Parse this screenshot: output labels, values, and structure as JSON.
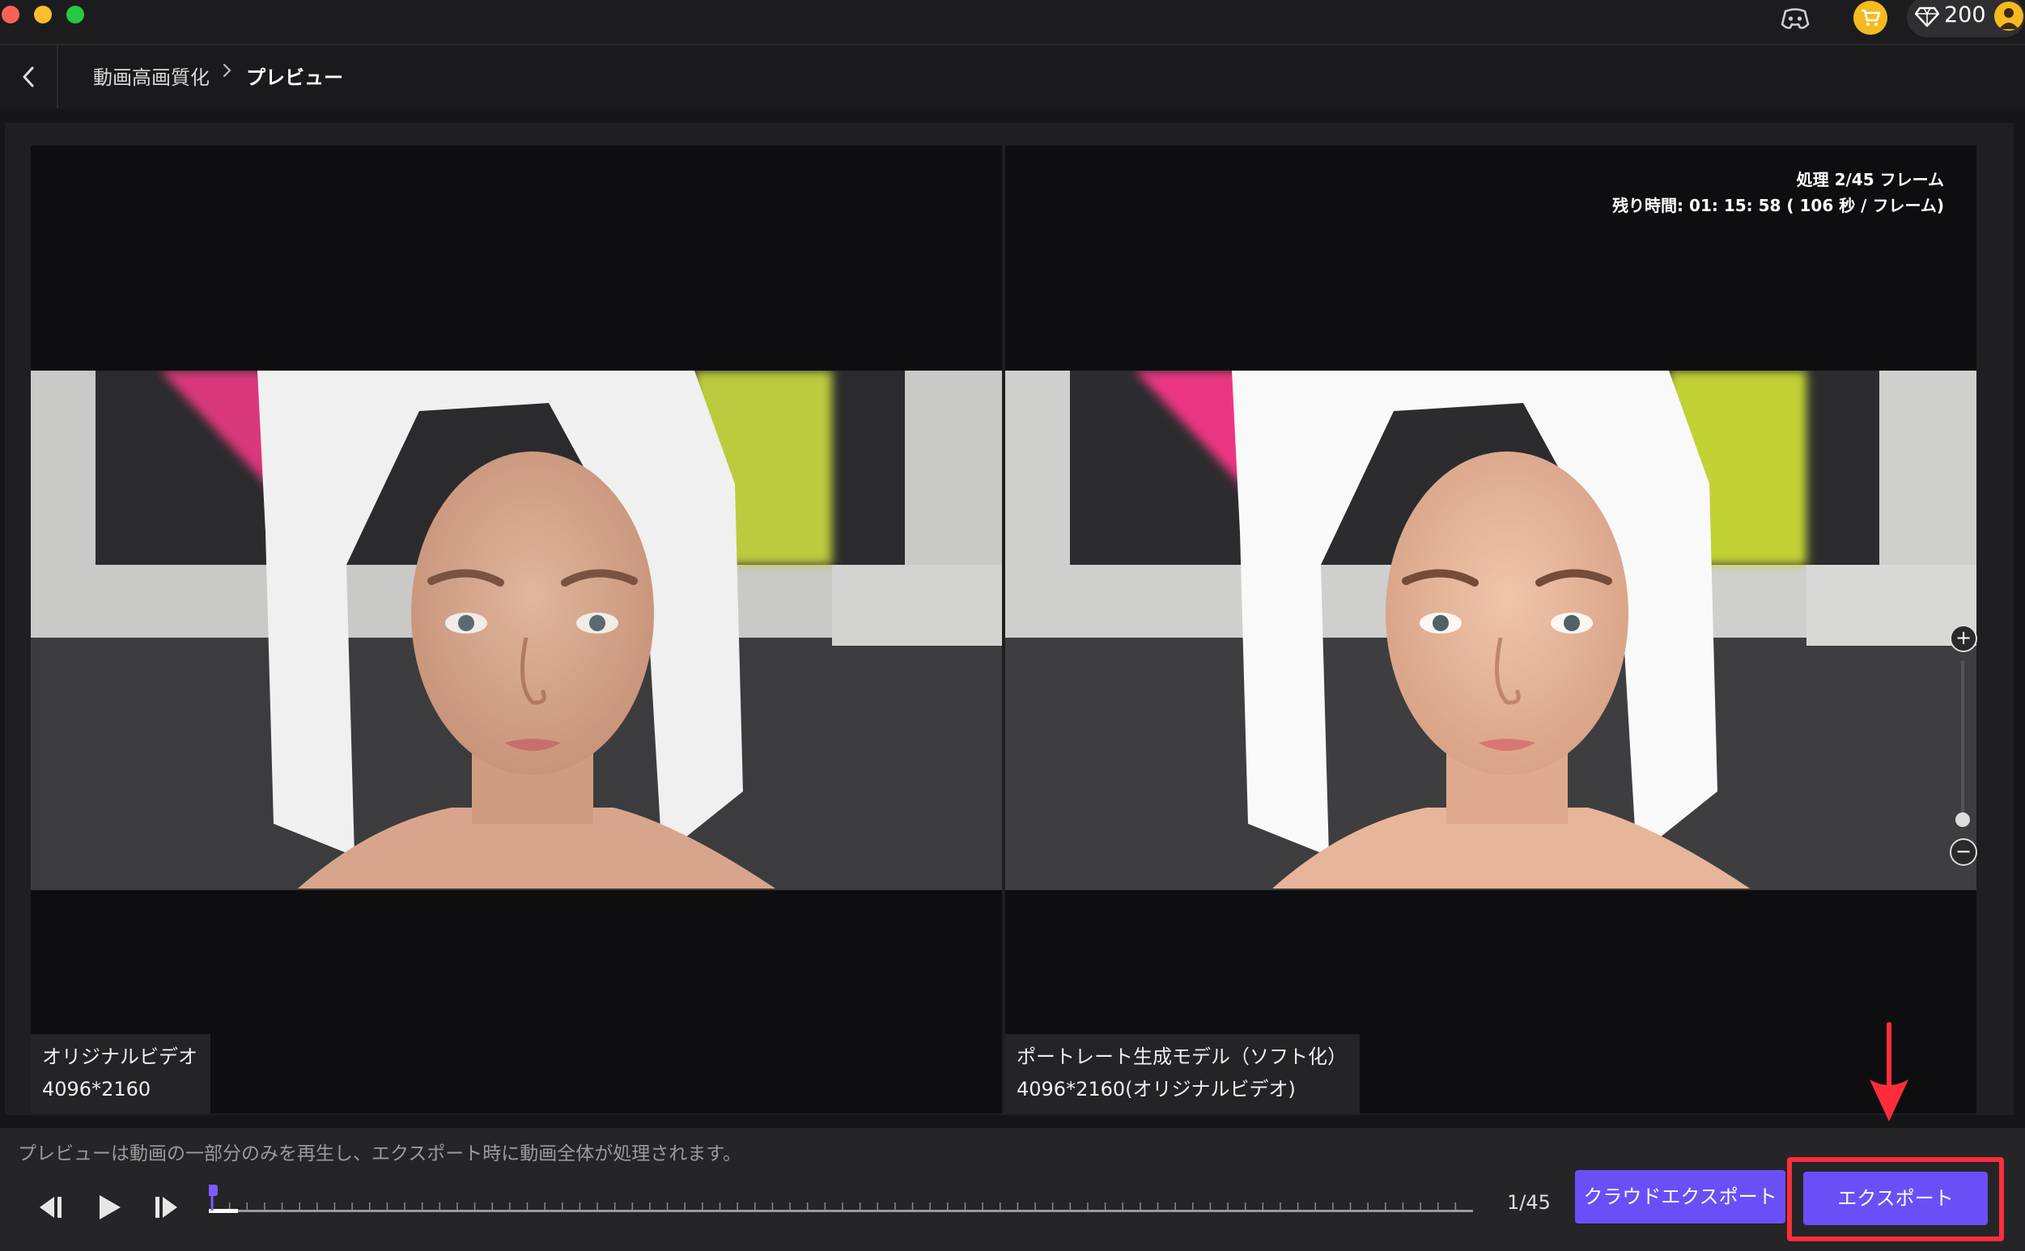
{
  "titlebar": {
    "credits": "200",
    "icons": {
      "discord": "discord-icon",
      "cart": "cart-icon",
      "gem": "gem-icon",
      "avatar": "user-avatar-icon"
    },
    "colors": {
      "close": "#fe5f57",
      "minimize": "#febc2e",
      "zoom": "#28c840",
      "cart_bg": "#f6b91f"
    }
  },
  "breadcrumb": {
    "parent": "動画高画質化",
    "current": "プレビュー"
  },
  "preview": {
    "status_line1": "処理 2/45 フレーム",
    "status_line2": "残り時間: 01: 15: 58 ( 106 秒 / フレーム)",
    "left": {
      "title": "オリジナルビデオ",
      "resolution": "4096*2160"
    },
    "right": {
      "title": "ポートレート生成モデル（ソフト化）",
      "resolution": "4096*2160(オリジナルビデオ)"
    },
    "zoom": {
      "plus": "+",
      "minus": "−"
    }
  },
  "controls": {
    "hint": "プレビューは動画の一部分のみを再生し、エクスポート時に動画全体が処理されます。",
    "frame_counter": "1/45",
    "playhead_position": 1,
    "total_frames": 45,
    "cloud_export_label": "クラウドエクスポート",
    "export_label": "エクスポート",
    "accent_color": "#6b4ff6",
    "highlight_color": "#ff2d3a"
  }
}
